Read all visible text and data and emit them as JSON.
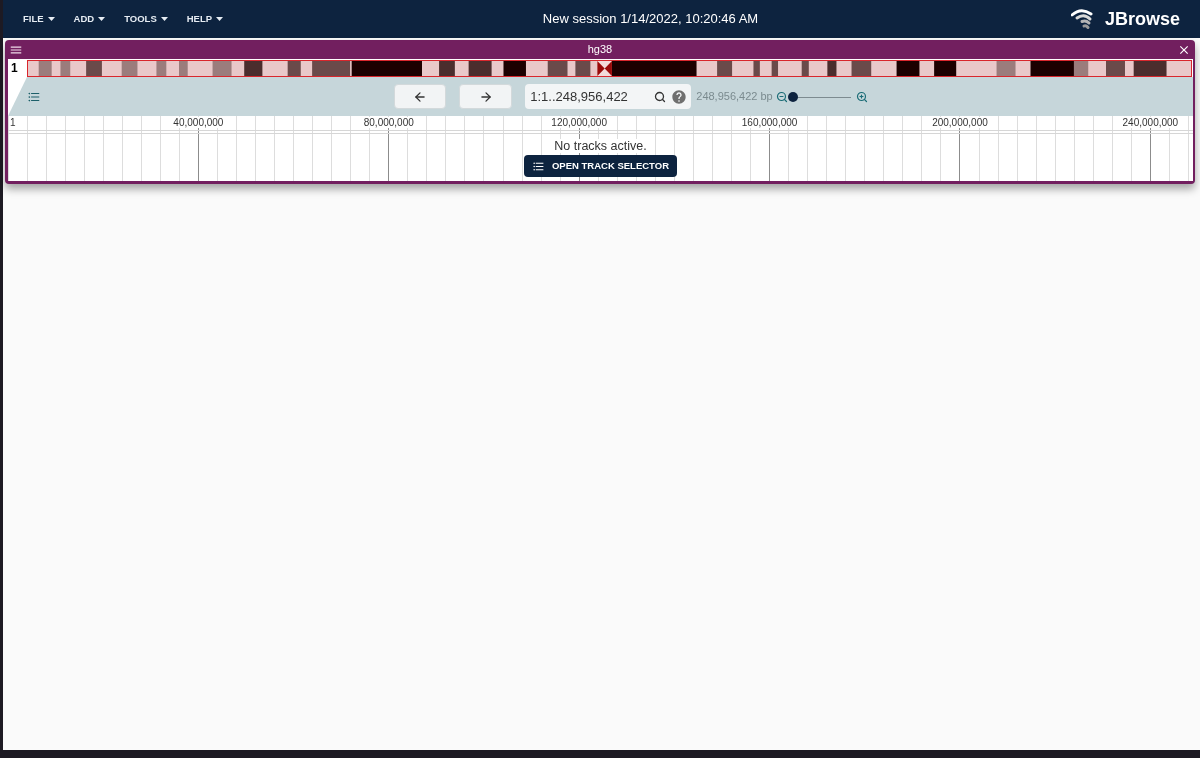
{
  "menu": [
    {
      "label": "FILE"
    },
    {
      "label": "ADD"
    },
    {
      "label": "TOOLS"
    },
    {
      "label": "HELP"
    }
  ],
  "session_title": "New session 1/14/2022, 10:20:46 AM",
  "logo": "JBrowse",
  "view": {
    "title": "hg38",
    "chromosome": "1",
    "navigation": {
      "locstring": "1:1..248,956,422",
      "region_size": "248,956,422 bp",
      "zoom": {
        "level": 0
      }
    },
    "ruler": [
      "1",
      "40,000,000",
      "80,000,000",
      "120,000,000",
      "160,000,000",
      "200,000,000",
      "240,000,000"
    ],
    "message": "No tracks active.",
    "open_track_selector": "OPEN TRACK SELECTOR"
  }
}
